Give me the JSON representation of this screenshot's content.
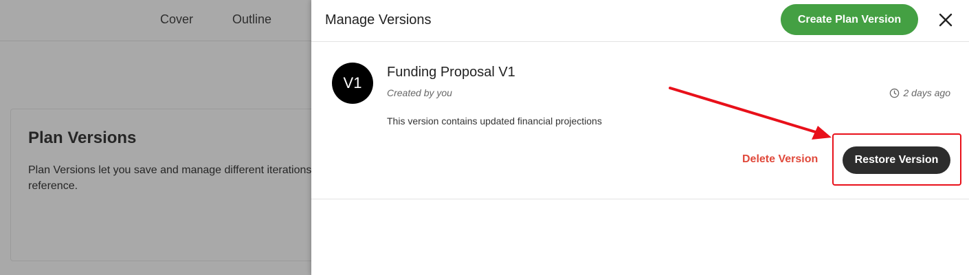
{
  "background": {
    "tabs": [
      {
        "label": "Cover"
      },
      {
        "label": "Outline"
      }
    ],
    "card": {
      "title": "Plan Versions",
      "text": "Plan Versions let you save and manage different iterations\nreference."
    }
  },
  "drawer": {
    "title": "Manage Versions",
    "create_button": "Create Plan Version",
    "close_icon": "close-icon",
    "versions": [
      {
        "avatar": "V1",
        "name": "Funding Proposal V1",
        "created_by": "Created by you",
        "timestamp": "2 days ago",
        "description": "This version contains updated financial projections",
        "delete_label": "Delete Version",
        "restore_label": "Restore Version"
      }
    ]
  },
  "colors": {
    "accent_green": "#44a043",
    "danger_red": "#e0493b",
    "annotation_red": "#e8101a",
    "dark_button": "#2d2d2d"
  }
}
